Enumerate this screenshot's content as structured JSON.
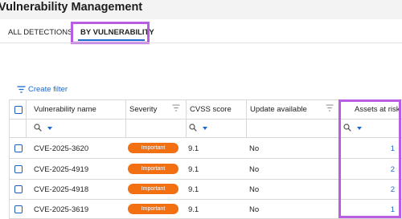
{
  "page_title": "Vulnerability Management",
  "tabs": [
    {
      "label": "ALL DETECTIONS",
      "active": false
    },
    {
      "label": "BY VULNERABILITY",
      "active": true
    }
  ],
  "toolbar": {
    "create_filter_label": "Create filter"
  },
  "table": {
    "columns": [
      {
        "label": "Vulnerability name",
        "filterable": false
      },
      {
        "label": "Severity",
        "filterable": true
      },
      {
        "label": "CVSS score",
        "filterable": false
      },
      {
        "label": "Update available",
        "filterable": true
      },
      {
        "label": "Assets at risk",
        "filterable": false
      }
    ],
    "rows": [
      {
        "name": "CVE-2025-3620",
        "severity": "Important",
        "cvss": "9.1",
        "update": "No",
        "assets": "1"
      },
      {
        "name": "CVE-2025-4919",
        "severity": "Important",
        "cvss": "9.1",
        "update": "No",
        "assets": "2"
      },
      {
        "name": "CVE-2025-4918",
        "severity": "Important",
        "cvss": "9.1",
        "update": "No",
        "assets": "2"
      },
      {
        "name": "CVE-2025-3619",
        "severity": "Important",
        "cvss": "9.1",
        "update": "No",
        "assets": "1"
      }
    ]
  },
  "colors": {
    "accent": "#1b6ad1",
    "highlight": "#b95de2",
    "severity_important": "#f26f12"
  },
  "icons": [
    "filter-lines-icon",
    "search-icon",
    "chevron-down-icon",
    "checkbox-icon"
  ]
}
